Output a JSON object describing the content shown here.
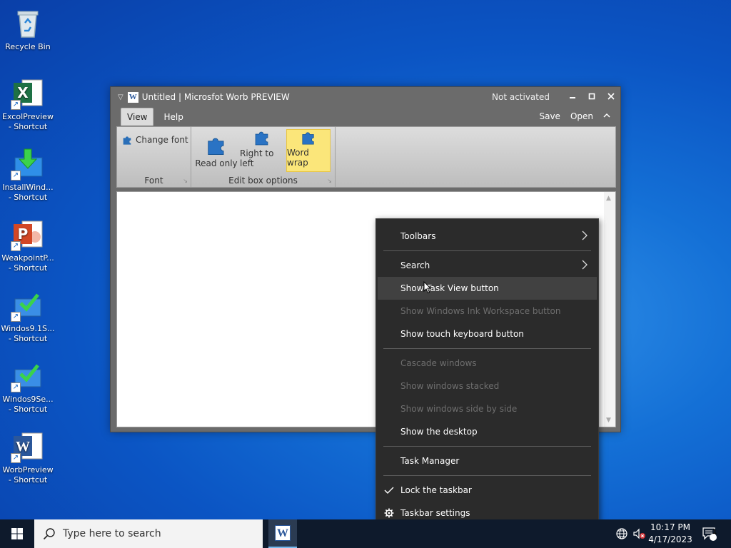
{
  "desktop": {
    "icons": [
      {
        "label1": "Recycle Bin",
        "label2": ""
      },
      {
        "label1": "ExcolPreview",
        "label2": "- Shortcut"
      },
      {
        "label1": "InstallWind...",
        "label2": "- Shortcut"
      },
      {
        "label1": "WeakpointP...",
        "label2": "- Shortcut"
      },
      {
        "label1": "Windos9.1S...",
        "label2": "- Shortcut"
      },
      {
        "label1": "Windos9Se...",
        "label2": "- Shortcut"
      },
      {
        "label1": "WorbPreview",
        "label2": "- Shortcut"
      }
    ]
  },
  "window": {
    "title": "Untitled | Microsfot Worb PREVIEW",
    "status": "Not activated",
    "tabs": [
      "View",
      "Help"
    ],
    "right_links": [
      "Save",
      "Open"
    ],
    "groups": {
      "font": {
        "label": "Font",
        "change_font": "Change font"
      },
      "edit": {
        "label": "Edit box options",
        "buttons": [
          {
            "label": "Read only",
            "active": false
          },
          {
            "label": "Right to left",
            "active": false
          },
          {
            "label": "Word wrap",
            "active": true
          }
        ]
      }
    }
  },
  "context_menu": {
    "items": [
      {
        "label": "Toolbars",
        "enabled": true,
        "submenu": true
      },
      {
        "label": "Search",
        "enabled": true,
        "submenu": true
      },
      {
        "label": "Show Task View button",
        "enabled": true,
        "hover": true
      },
      {
        "label": "Show Windows Ink Workspace button",
        "enabled": false
      },
      {
        "label": "Show touch keyboard button",
        "enabled": true
      },
      {
        "label": "Cascade windows",
        "enabled": false
      },
      {
        "label": "Show windows stacked",
        "enabled": false
      },
      {
        "label": "Show windows side by side",
        "enabled": false
      },
      {
        "label": "Show the desktop",
        "enabled": true
      },
      {
        "label": "Task Manager",
        "enabled": true
      },
      {
        "label": "Lock the taskbar",
        "enabled": true,
        "checked": true
      },
      {
        "label": "Taskbar settings",
        "enabled": true,
        "icon": "gear-icon"
      }
    ]
  },
  "taskbar": {
    "search_placeholder": "Type here to search",
    "time": "10:17 PM",
    "date": "4/17/2023",
    "notification_count": "1"
  },
  "colors": {
    "accent": "#0b55c4",
    "menu_bg": "#2b2b2b",
    "active_button": "#fbe67a",
    "word_blue": "#2b579a"
  }
}
